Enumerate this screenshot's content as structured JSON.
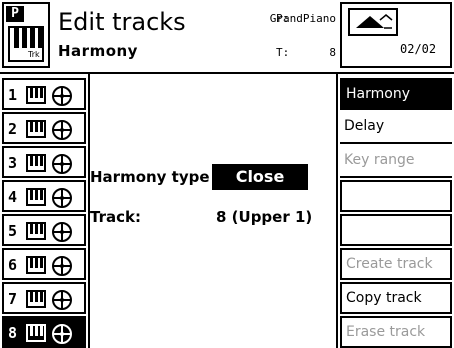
{
  "header": {
    "badge": "P",
    "icon_tag": "Trk",
    "title": "Edit tracks",
    "subtitle": "Harmony",
    "p_label": "P:",
    "p_value": "GrandPiano",
    "t_label": "T:",
    "t_value": "8",
    "page": "02/02",
    "nav_icon": "scroll-up-arrow-icon"
  },
  "tracks": [
    {
      "num": "1",
      "selected": false
    },
    {
      "num": "2",
      "selected": false
    },
    {
      "num": "3",
      "selected": false
    },
    {
      "num": "4",
      "selected": false
    },
    {
      "num": "5",
      "selected": false
    },
    {
      "num": "6",
      "selected": false
    },
    {
      "num": "7",
      "selected": false
    },
    {
      "num": "8",
      "selected": true
    }
  ],
  "main": {
    "harmony_type_label": "Harmony type",
    "harmony_type_value": "Close",
    "track_label": "Track:",
    "track_value": "8 (Upper 1)"
  },
  "menu": [
    {
      "label": "Harmony",
      "state": "selected"
    },
    {
      "label": "Delay",
      "state": "normal"
    },
    {
      "label": "Key range",
      "state": "disabled"
    },
    {
      "label": "",
      "state": "empty"
    },
    {
      "label": "",
      "state": "empty"
    },
    {
      "label": "Create track",
      "state": "disabled"
    },
    {
      "label": "Copy track",
      "state": "normal"
    },
    {
      "label": "Erase track",
      "state": "disabled"
    }
  ],
  "colors": {
    "foreground": "#000000",
    "background": "#ffffff",
    "disabled": "#9a9a9a"
  }
}
